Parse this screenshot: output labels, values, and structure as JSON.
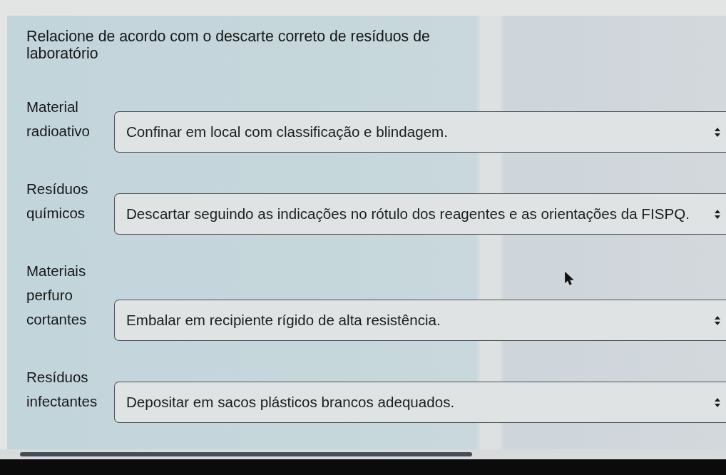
{
  "question": {
    "text": "Relacione de acordo com o descarte correto de resíduos de laboratório"
  },
  "pairs": [
    {
      "label": "Material radioativo",
      "value": "Confinar em local com classificação e blindagem."
    },
    {
      "label": "Resíduos químicos",
      "value": "Descartar seguindo as indicações no rótulo dos reagentes e as orientações da FISPQ."
    },
    {
      "label": "Materiais perfuro cortantes",
      "value": "Embalar em recipiente rígido de alta resistência."
    },
    {
      "label": "Resíduos infectantes",
      "value": "Depositar em sacos plásticos brancos adequados."
    }
  ]
}
